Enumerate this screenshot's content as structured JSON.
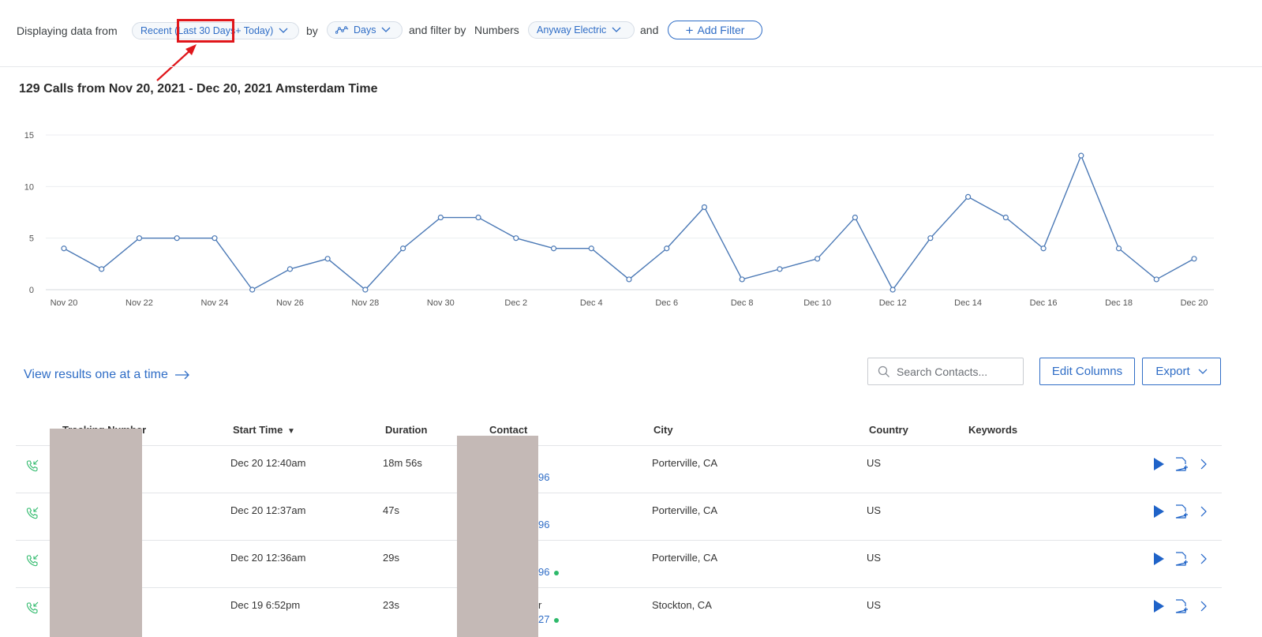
{
  "filter_bar": {
    "prefix": "Displaying data from",
    "date_pill": {
      "part1": "Recent (",
      "part2": "Last 30 Days",
      "part3": " + Today)"
    },
    "by_label": "by",
    "interval_pill": "Days",
    "filter_label": "and filter by",
    "numbers_label": "Numbers",
    "numbers_pill": "Anyway Electric",
    "and_label": "and",
    "add_filter": "Add Filter"
  },
  "colors": {
    "accent": "#2f6dc6",
    "annotation": "#e0161b",
    "line": "#4a78b5",
    "green": "#2db96a",
    "redaction": "#c4b9b6"
  },
  "chart_title": "129 Calls from Nov 20, 2021 - Dec 20, 2021 Amsterdam Time",
  "chart_data": {
    "type": "line",
    "title": "129 Calls from Nov 20, 2021 - Dec 20, 2021 Amsterdam Time",
    "xlabel": "",
    "ylabel": "",
    "ylim": [
      0,
      15
    ],
    "yticks": [
      0,
      5,
      10,
      15
    ],
    "x": [
      "Nov 20",
      "Nov 21",
      "Nov 22",
      "Nov 23",
      "Nov 24",
      "Nov 25",
      "Nov 26",
      "Nov 27",
      "Nov 28",
      "Nov 29",
      "Nov 30",
      "Dec 1",
      "Dec 2",
      "Dec 3",
      "Dec 4",
      "Dec 5",
      "Dec 6",
      "Dec 7",
      "Dec 8",
      "Dec 9",
      "Dec 10",
      "Dec 11",
      "Dec 12",
      "Dec 13",
      "Dec 14",
      "Dec 15",
      "Dec 16",
      "Dec 17",
      "Dec 18",
      "Dec 19",
      "Dec 20"
    ],
    "xtick_labels": [
      "Nov 20",
      "Nov 22",
      "Nov 24",
      "Nov 26",
      "Nov 28",
      "Nov 30",
      "Dec 2",
      "Dec 4",
      "Dec 6",
      "Dec 8",
      "Dec 10",
      "Dec 12",
      "Dec 14",
      "Dec 16",
      "Dec 18",
      "Dec 20"
    ],
    "series": [
      {
        "values": [
          4,
          2,
          5,
          5,
          5,
          0,
          2,
          3,
          0,
          4,
          7,
          7,
          5,
          4,
          4,
          1,
          4,
          8,
          1,
          2,
          3,
          7,
          0,
          5,
          9,
          7,
          4,
          13,
          4,
          1,
          3
        ]
      }
    ],
    "grid": true
  },
  "results": {
    "view_link": "View results one at a time",
    "search_placeholder": "Search Contacts...",
    "edit_columns": "Edit Columns",
    "export": "Export"
  },
  "table": {
    "headers": {
      "tracking": "Tracking Number",
      "start": "Start Time",
      "duration": "Duration",
      "contact": "Contact",
      "city": "City",
      "country": "Country",
      "keywords": "Keywords"
    },
    "rows": [
      {
        "start": "Dec 20 12:40am",
        "duration": "18m 56s",
        "contact_tail": "96",
        "city": "Porterville, CA",
        "country": "US"
      },
      {
        "start": "Dec 20 12:37am",
        "duration": "47s",
        "contact_tail": "96",
        "city": "Porterville, CA",
        "country": "US"
      },
      {
        "start": "Dec 20 12:36am",
        "duration": "29s",
        "contact_tail": "96",
        "city": "Porterville, CA",
        "country": "US"
      },
      {
        "start": "Dec 19 6:52pm",
        "duration": "23s",
        "contact_name_tail": "r",
        "contact_tail": "27",
        "city": "Stockton, CA",
        "country": "US"
      }
    ]
  }
}
